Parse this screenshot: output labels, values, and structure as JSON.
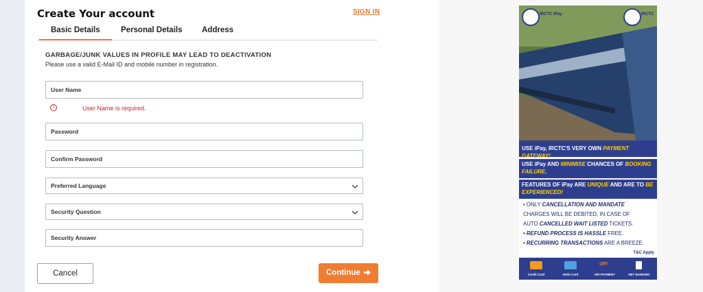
{
  "header": {
    "title": "Create Your account",
    "sign_in": "SIGN IN"
  },
  "tabs": [
    {
      "label": "Basic Details",
      "active": true
    },
    {
      "label": "Personal Details",
      "active": false
    },
    {
      "label": "Address",
      "active": false
    }
  ],
  "notice": {
    "title": "GARBAGE/JUNK VALUES IN PROFILE MAY LEAD TO DEACTIVATION",
    "subtitle": "Please use a valid E-Mail ID and mobile number in registration."
  },
  "fields": {
    "username": {
      "placeholder": "User Name",
      "error": "User Name is required."
    },
    "password": {
      "placeholder": "Password"
    },
    "confirm_password": {
      "placeholder": "Confirm Password"
    },
    "preferred_language": {
      "placeholder": "Preferred Language"
    },
    "security_question": {
      "placeholder": "Security Question"
    },
    "security_answer": {
      "placeholder": "Security Answer"
    }
  },
  "buttons": {
    "cancel": "Cancel",
    "continue": "Continue"
  },
  "ad": {
    "logo_left": "IRCTC iPay",
    "logo_right": "IRCTC",
    "band1": {
      "pre": "USE iPay, IRCTC'S VERY OWN ",
      "hl": "PAYMENT GATEWAY!"
    },
    "band2": {
      "pre": "USE iPay AND ",
      "hl1": "MINIMISE",
      "mid": " CHANCES OF ",
      "hl2": "BOOKING FAILURE",
      "post": "."
    },
    "band3": {
      "pre": "FEATURES OF iPay ARE ",
      "hl1": "UNIQUE",
      "mid": " AND ARE TO ",
      "hl2": "BE EXPERIENCED!"
    },
    "bullets": {
      "b1_pre": "• ONLY ",
      "b1_em": "CANCELLATION AND MANDATE",
      "b1_l2": "CHARGES WILL BE DEBITED, IN CASE OF",
      "b1_l3_pre": "AUTO ",
      "b1_l3_em": "CANCELLED WAIT LISTED",
      "b1_l3_post": " TICKETS.",
      "b2_em": "• REFUND PROCESS IS HASSLE",
      "b2_post": " FREE.",
      "b3_em": "• RECURRING TRANSACTIONS",
      "b3_post": " ARE A BREEZE."
    },
    "tc": "T&C Apply",
    "payments": [
      "Credit Card",
      "Debit Card",
      "UPI PAYMENT",
      "NET BANKING"
    ]
  },
  "colors": {
    "accent": "#f07c32",
    "error": "#c7242b",
    "ad_blue": "#2e3e8e",
    "ad_yellow": "#ffd000"
  }
}
